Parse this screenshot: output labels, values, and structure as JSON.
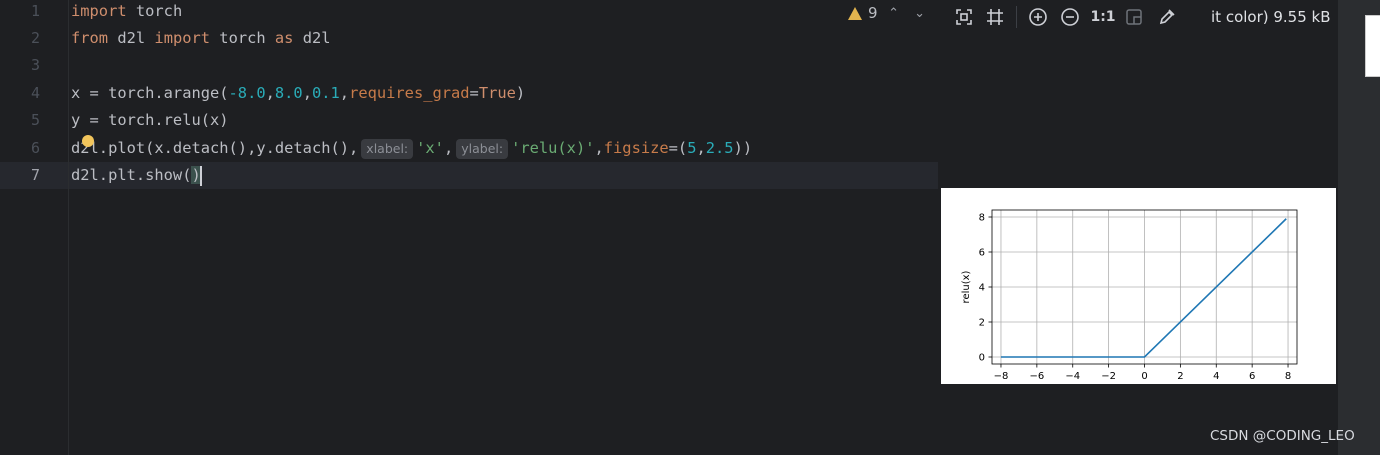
{
  "editor": {
    "line_numbers": [
      "1",
      "2",
      "3",
      "4",
      "5",
      "6",
      "7"
    ],
    "warnings_count": "9",
    "hints": {
      "xlabel": "xlabel:",
      "ylabel": "ylabel:"
    },
    "line1": {
      "kw": "import",
      "rest": " torch"
    },
    "line2": {
      "kw1": "from",
      "mod": " d2l ",
      "kw2": "import",
      "mid": " torch ",
      "kw3": "as",
      "alias": " d2l"
    },
    "line4": {
      "start": "x = torch.arange(",
      "n1": "-8.0",
      "n2": "8.0",
      "n3": "0.1",
      "param": "requires_grad",
      "eq": "=",
      "val": "True",
      "end": ")"
    },
    "line5": {
      "text": "y = torch.relu(x)"
    },
    "line6": {
      "start": "d2l.plot(x.detach()",
      "mid": "y.detach()",
      "s1": "'x'",
      "s2": "'relu(x)'",
      "param": "figsize",
      "eq": "=(",
      "n1": "5",
      "n2": "2.5",
      "end": "))"
    },
    "line7": {
      "start": "d2l.plt.show(",
      "end": ")"
    }
  },
  "viewer": {
    "zoom_label": "1:1",
    "file_info": "it color) 9.55 kB",
    "icons": [
      "fit-icon",
      "grid-icon",
      "zoom-in-icon",
      "zoom-out-icon",
      "actual-size-icon",
      "background-icon",
      "color-picker-icon"
    ]
  },
  "chart_data": {
    "type": "line",
    "ylabel": "relu(x)",
    "xlabel": "",
    "xlim": [
      -8.5,
      8.5
    ],
    "ylim": [
      -0.4,
      8.4
    ],
    "xticks": [
      -8,
      -6,
      -4,
      -2,
      0,
      2,
      4,
      6,
      8
    ],
    "xtick_labels": [
      "−8",
      "−6",
      "−4",
      "−2",
      "0",
      "2",
      "4",
      "6",
      "8"
    ],
    "yticks": [
      0,
      2,
      4,
      6,
      8
    ],
    "ytick_labels": [
      "0",
      "2",
      "4",
      "6",
      "8"
    ],
    "grid": true,
    "series": [
      {
        "x": [
          -8.0,
          0.0,
          7.9
        ],
        "y": [
          0.0,
          0.0,
          7.9
        ],
        "color": "#1f77b4"
      }
    ]
  },
  "watermark": "CSDN @CODING_LEO"
}
